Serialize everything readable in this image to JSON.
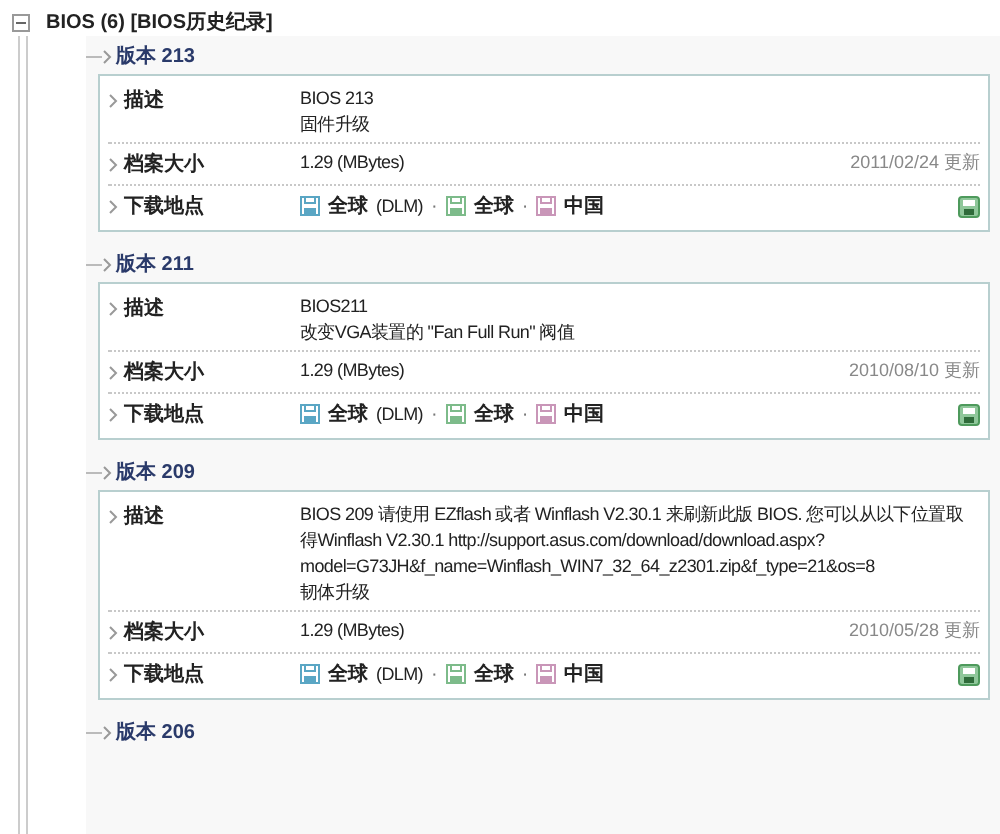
{
  "section": {
    "title": "BIOS (6) [BIOS历史纪录]",
    "expanded": true
  },
  "versions": [
    {
      "label": "版本 213",
      "card": {
        "desc_label": "描述",
        "description": [
          "BIOS 213",
          "固件升级"
        ],
        "size_label": "档案大小",
        "size": "1.29 (MBytes)",
        "date": "2011/02/24 更新",
        "download_label": "下载地点",
        "links": [
          {
            "text": "全球",
            "note": "(DLM)",
            "color": "#5aa6c4"
          },
          {
            "prefix": "·",
            "text": "全球",
            "color": "#7dbb8a"
          },
          {
            "prefix": "·",
            "text": "中国",
            "color": "#c996b8"
          }
        ]
      }
    },
    {
      "label": "版本 211",
      "card": {
        "desc_label": "描述",
        "description": [
          "BIOS211",
          "改变VGA装置的 \"Fan Full Run\" 阀值"
        ],
        "size_label": "档案大小",
        "size": "1.29 (MBytes)",
        "date": "2010/08/10 更新",
        "download_label": "下载地点",
        "links": [
          {
            "text": "全球",
            "note": "(DLM)",
            "color": "#5aa6c4"
          },
          {
            "prefix": "·",
            "text": "全球",
            "color": "#7dbb8a"
          },
          {
            "prefix": "·",
            "text": "中国",
            "color": "#c996b8"
          }
        ]
      }
    },
    {
      "label": "版本 209",
      "card": {
        "desc_label": "描述",
        "description": [
          "BIOS 209 请使用  EZflash 或者  Winflash V2.30.1 来刷新此版  BIOS. 您可以从以下位置取",
          "得Winflash V2.30.1 http://support.asus.com/download/download.aspx?",
          "model=G73JH&f_name=Winflash_WIN7_32_64_z2301.zip&f_type=21&os=8",
          "韧体升级"
        ],
        "size_label": "档案大小",
        "size": "1.29 (MBytes)",
        "date": "2010/05/28 更新",
        "download_label": "下载地点",
        "links": [
          {
            "text": "全球",
            "note": "(DLM)",
            "color": "#5aa6c4"
          },
          {
            "prefix": "·",
            "text": "全球",
            "color": "#7dbb8a"
          },
          {
            "prefix": "·",
            "text": "中国",
            "color": "#c996b8"
          }
        ]
      }
    },
    {
      "label": "版本 206"
    }
  ]
}
